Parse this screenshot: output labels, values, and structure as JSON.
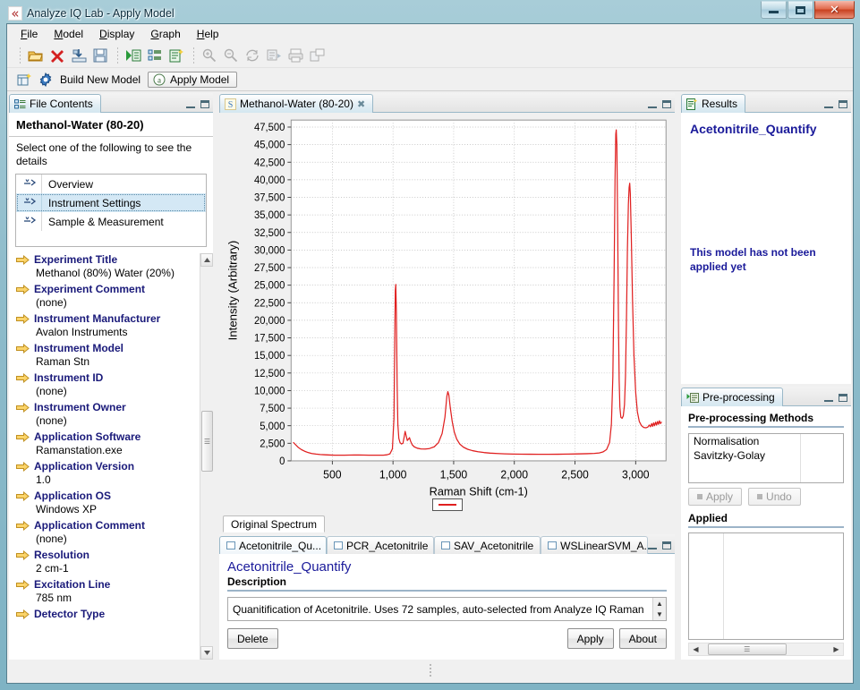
{
  "window": {
    "title": "Analyze IQ Lab - Apply Model",
    "icon": "app-icon",
    "minimize": "minimize",
    "maximize": "maximize",
    "close": "close"
  },
  "menubar": [
    {
      "label": "File",
      "mnemonic": "F"
    },
    {
      "label": "Model",
      "mnemonic": "M"
    },
    {
      "label": "Display",
      "mnemonic": "D"
    },
    {
      "label": "Graph",
      "mnemonic": "G"
    },
    {
      "label": "Help",
      "mnemonic": "H"
    }
  ],
  "toolbar": {
    "group1": [
      "open-folder-icon",
      "delete-red-x-icon",
      "import-icon",
      "save-disk-icon"
    ],
    "group2": [
      "run-model-icon",
      "properties-list-icon",
      "new-model-icon"
    ],
    "group3": [
      "zoom-in-icon",
      "zoom-out-icon",
      "pan-icon",
      "export-image-icon",
      "print-icon",
      "tile-windows-icon"
    ]
  },
  "toolbar2": {
    "perspective_icon": "new-perspective-icon",
    "build_icon": "gear-icon",
    "build_label": "Build New Model",
    "apply_icon": "apply-model-icon",
    "apply_label": "Apply Model"
  },
  "file_contents": {
    "tab_label": "File Contents",
    "tab_icon": "file-contents-icon",
    "heading": "Methanol-Water (80-20)",
    "prompt": "Select one of the following to see the details",
    "list": [
      {
        "label": "Overview",
        "selected": false
      },
      {
        "label": "Instrument Settings",
        "selected": true
      },
      {
        "label": "Sample & Measurement",
        "selected": false
      }
    ],
    "fields": [
      {
        "key": "Experiment Title",
        "value": "Methanol (80%) Water (20%)"
      },
      {
        "key": "Experiment Comment",
        "value": "(none)"
      },
      {
        "key": "Instrument Manufacturer",
        "value": "Avalon Instruments"
      },
      {
        "key": "Instrument Model",
        "value": "Raman Stn"
      },
      {
        "key": "Instrument ID",
        "value": "(none)"
      },
      {
        "key": "Instrument Owner",
        "value": "(none)"
      },
      {
        "key": "Application Software",
        "value": "Ramanstation.exe"
      },
      {
        "key": "Application Version",
        "value": "1.0"
      },
      {
        "key": "Application OS",
        "value": "Windows XP"
      },
      {
        "key": "Application Comment",
        "value": "(none)"
      },
      {
        "key": "Resolution",
        "value": "2 cm-1"
      },
      {
        "key": "Excitation Line",
        "value": "785 nm"
      },
      {
        "key": "Detector Type",
        "value": ""
      }
    ]
  },
  "spectrum_editor": {
    "tab_label": "Methanol-Water (80-20)",
    "tab_icon": "spectrum-icon",
    "tab_icon_letter": "S",
    "close_icon": "close-icon",
    "bottom_tab": "Original Spectrum",
    "legend_color": "#e02020"
  },
  "chart_data": {
    "type": "line",
    "title": "",
    "xlabel": "Raman Shift (cm-1)",
    "ylabel": "Intensity (Arbitrary)",
    "xlim": [
      160,
      3250
    ],
    "ylim": [
      0,
      48500
    ],
    "xticks": [
      500,
      1000,
      1500,
      2000,
      2500,
      3000
    ],
    "xtick_labels": [
      "500",
      "1,000",
      "1,500",
      "2,000",
      "2,500",
      "3,000"
    ],
    "yticks": [
      0,
      2500,
      5000,
      7500,
      10000,
      12500,
      15000,
      17500,
      20000,
      22500,
      25000,
      27500,
      30000,
      32500,
      35000,
      37500,
      40000,
      42500,
      45000,
      47500
    ],
    "ytick_labels": [
      "0",
      "2,500",
      "5,000",
      "7,500",
      "10,000",
      "12,500",
      "15,000",
      "17,500",
      "20,000",
      "22,500",
      "25,000",
      "27,500",
      "30,000",
      "32,500",
      "35,000",
      "37,500",
      "40,000",
      "42,500",
      "45,000",
      "47,500"
    ],
    "grid": true,
    "legend": "bottom",
    "series": [
      {
        "name": "Original Spectrum",
        "color": "#e02020",
        "points": [
          [
            180,
            2600
          ],
          [
            200,
            2250
          ],
          [
            220,
            1900
          ],
          [
            245,
            1600
          ],
          [
            270,
            1380
          ],
          [
            300,
            1180
          ],
          [
            330,
            1050
          ],
          [
            365,
            960
          ],
          [
            400,
            900
          ],
          [
            440,
            860
          ],
          [
            480,
            830
          ],
          [
            520,
            810
          ],
          [
            560,
            800
          ],
          [
            600,
            800
          ],
          [
            640,
            820
          ],
          [
            680,
            830
          ],
          [
            720,
            830
          ],
          [
            760,
            820
          ],
          [
            800,
            810
          ],
          [
            840,
            800
          ],
          [
            880,
            800
          ],
          [
            920,
            810
          ],
          [
            950,
            860
          ],
          [
            975,
            1000
          ],
          [
            995,
            1700
          ],
          [
            1008,
            6000
          ],
          [
            1014,
            16000
          ],
          [
            1019,
            24200
          ],
          [
            1023,
            25100
          ],
          [
            1028,
            21000
          ],
          [
            1034,
            11000
          ],
          [
            1040,
            5200
          ],
          [
            1048,
            3200
          ],
          [
            1058,
            2600
          ],
          [
            1070,
            2400
          ],
          [
            1082,
            2500
          ],
          [
            1092,
            3400
          ],
          [
            1100,
            4200
          ],
          [
            1108,
            3600
          ],
          [
            1118,
            2900
          ],
          [
            1128,
            3100
          ],
          [
            1136,
            3300
          ],
          [
            1145,
            2800
          ],
          [
            1158,
            2300
          ],
          [
            1175,
            2000
          ],
          [
            1200,
            1800
          ],
          [
            1230,
            1700
          ],
          [
            1265,
            1680
          ],
          [
            1300,
            1750
          ],
          [
            1340,
            2000
          ],
          [
            1375,
            2600
          ],
          [
            1405,
            3900
          ],
          [
            1428,
            6200
          ],
          [
            1444,
            9200
          ],
          [
            1452,
            9850
          ],
          [
            1460,
            9400
          ],
          [
            1472,
            7600
          ],
          [
            1488,
            5600
          ],
          [
            1505,
            4100
          ],
          [
            1525,
            3100
          ],
          [
            1550,
            2400
          ],
          [
            1580,
            1950
          ],
          [
            1615,
            1650
          ],
          [
            1655,
            1450
          ],
          [
            1700,
            1300
          ],
          [
            1750,
            1180
          ],
          [
            1800,
            1100
          ],
          [
            1860,
            1040
          ],
          [
            1920,
            1000
          ],
          [
            1990,
            970
          ],
          [
            2060,
            950
          ],
          [
            2130,
            940
          ],
          [
            2200,
            930
          ],
          [
            2280,
            930
          ],
          [
            2360,
            940
          ],
          [
            2440,
            960
          ],
          [
            2520,
            990
          ],
          [
            2600,
            1020
          ],
          [
            2660,
            1060
          ],
          [
            2700,
            1120
          ],
          [
            2730,
            1260
          ],
          [
            2760,
            1600
          ],
          [
            2785,
            2600
          ],
          [
            2800,
            5200
          ],
          [
            2812,
            12000
          ],
          [
            2822,
            26000
          ],
          [
            2830,
            40000
          ],
          [
            2836,
            46500
          ],
          [
            2840,
            47100
          ],
          [
            2845,
            45000
          ],
          [
            2852,
            33000
          ],
          [
            2858,
            20000
          ],
          [
            2864,
            11500
          ],
          [
            2870,
            7600
          ],
          [
            2878,
            6200
          ],
          [
            2888,
            6050
          ],
          [
            2898,
            6400
          ],
          [
            2908,
            8000
          ],
          [
            2916,
            12000
          ],
          [
            2924,
            20000
          ],
          [
            2932,
            30000
          ],
          [
            2940,
            36500
          ],
          [
            2946,
            38900
          ],
          [
            2951,
            39500
          ],
          [
            2956,
            38000
          ],
          [
            2964,
            32000
          ],
          [
            2974,
            23000
          ],
          [
            2986,
            15000
          ],
          [
            3000,
            9800
          ],
          [
            3014,
            7000
          ],
          [
            3030,
            5600
          ],
          [
            3048,
            5000
          ],
          [
            3066,
            4750
          ],
          [
            3084,
            4700
          ],
          [
            3100,
            4800
          ],
          [
            3112,
            5100
          ],
          [
            3122,
            4850
          ],
          [
            3132,
            5300
          ],
          [
            3140,
            4900
          ],
          [
            3148,
            5400
          ],
          [
            3156,
            5000
          ],
          [
            3164,
            5500
          ],
          [
            3172,
            5100
          ],
          [
            3180,
            5600
          ],
          [
            3188,
            5200
          ],
          [
            3196,
            5700
          ],
          [
            3204,
            5300
          ],
          [
            3212,
            5500
          ]
        ]
      }
    ]
  },
  "model_editor": {
    "tabs": [
      {
        "label": "Acetonitrile_Qu...",
        "active": true
      },
      {
        "label": "PCR_Acetonitrile",
        "active": false
      },
      {
        "label": "SAV_Acetonitrile",
        "active": false
      },
      {
        "label": "WSLinearSVM_A...",
        "active": false
      }
    ],
    "title": "Acetonitrile_Quantify",
    "description_label": "Description",
    "description_value": "Quanitification of Acetonitrile. Uses 72 samples, auto-selected from Analyze IQ Raman",
    "buttons": {
      "delete": "Delete",
      "apply": "Apply",
      "about": "About"
    }
  },
  "results": {
    "tab_label": "Results",
    "tab_icon": "results-icon",
    "model_name": "Acetonitrile_Quantify",
    "message": "This model has not been applied yet"
  },
  "preprocessing": {
    "tab_label": "Pre-processing",
    "tab_icon": "preprocessing-icon",
    "methods_label": "Pre-processing Methods",
    "methods": [
      "Normalisation",
      "Savitzky-Golay"
    ],
    "apply_label": "Apply",
    "undo_label": "Undo",
    "applied_label": "Applied",
    "applied_items": []
  }
}
